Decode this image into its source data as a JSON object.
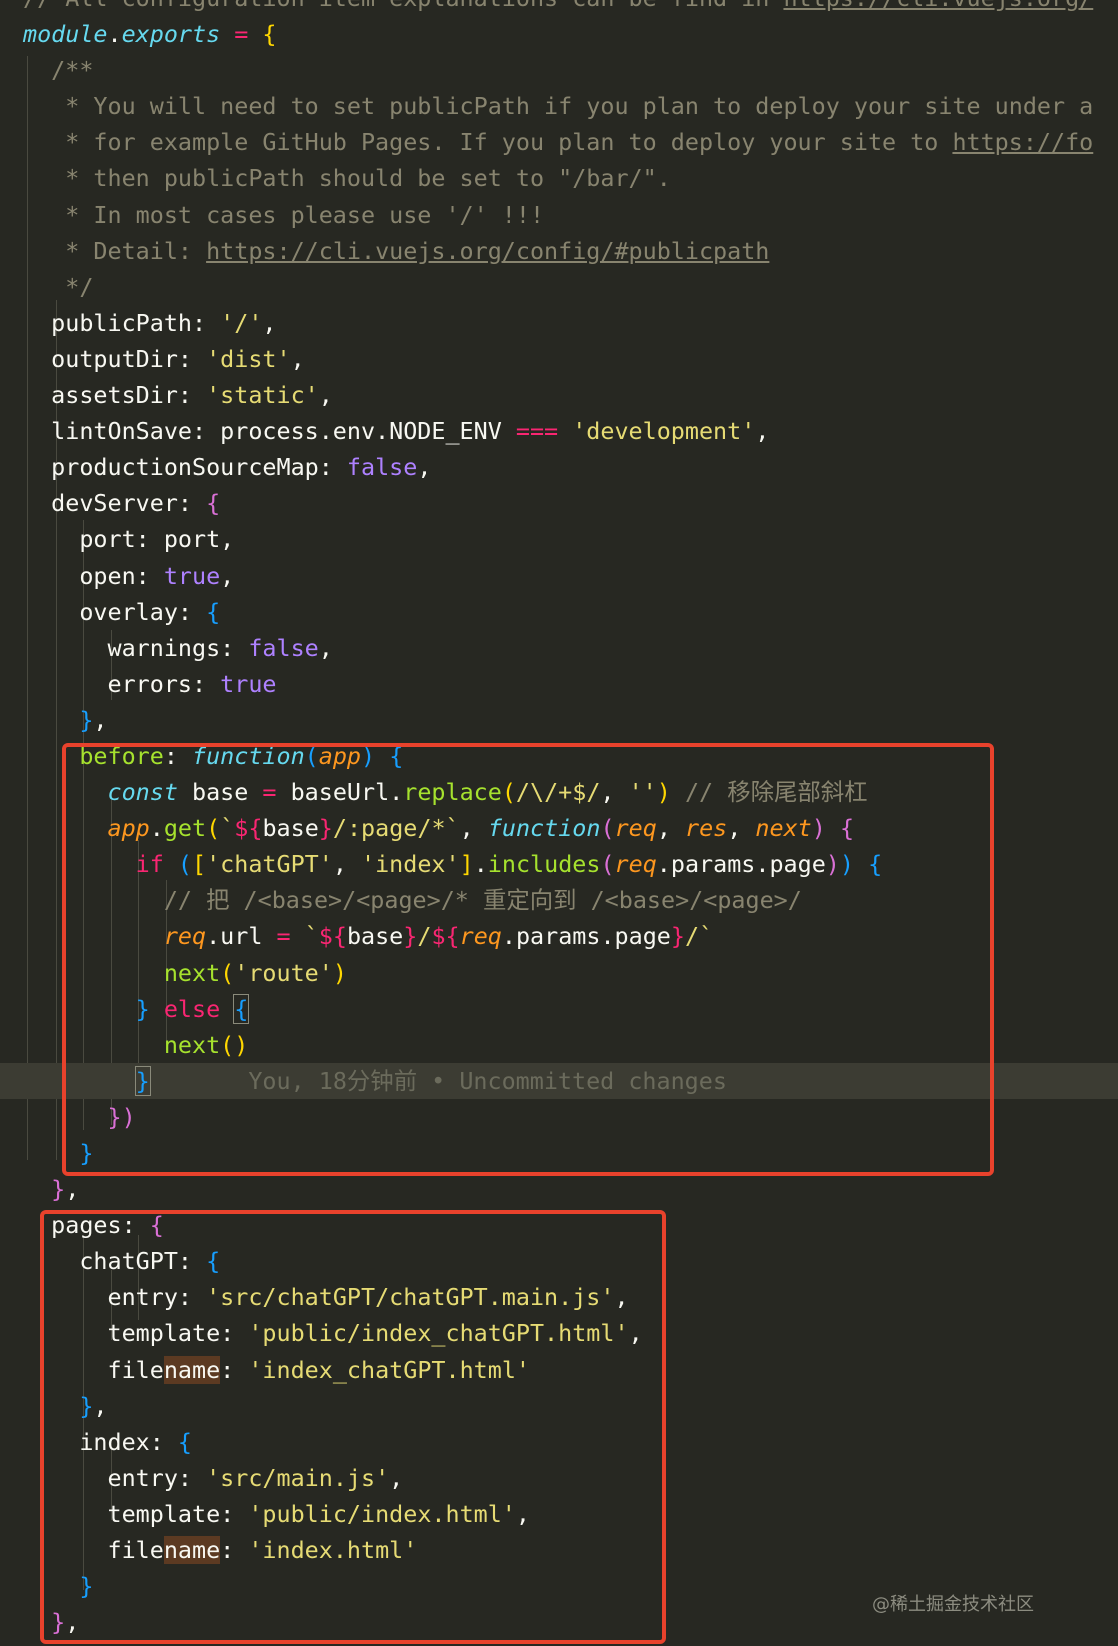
{
  "editor": {
    "lines": [
      {
        "segs": [
          [
            "t-com",
            "// All configuration item explanations can be find in "
          ],
          [
            "t-url",
            "https://cli.vuejs.org/"
          ]
        ]
      },
      {
        "segs": [
          [
            "t-store",
            "module"
          ],
          [
            "",
            "."
          ],
          [
            "t-store",
            "exports"
          ],
          [
            "t-kw",
            " = "
          ],
          [
            "t-b1",
            "{"
          ]
        ]
      },
      {
        "segs": [
          [
            "t-com",
            "  /**"
          ]
        ]
      },
      {
        "segs": [
          [
            "t-com",
            "   * You will need to set publicPath if you plan to deploy your site under a"
          ]
        ]
      },
      {
        "segs": [
          [
            "t-com",
            "   * for example GitHub Pages. If you plan to deploy your site to "
          ],
          [
            "t-url",
            "https://fo"
          ]
        ]
      },
      {
        "segs": [
          [
            "t-com",
            "   * then publicPath should be set to \"/bar/\"."
          ]
        ]
      },
      {
        "segs": [
          [
            "t-com",
            "   * In most cases please use '/' !!!"
          ]
        ]
      },
      {
        "segs": [
          [
            "t-com",
            "   * Detail: "
          ],
          [
            "t-url",
            "https://cli.vuejs.org/config/#publicpath"
          ]
        ]
      },
      {
        "segs": [
          [
            "t-com",
            "   */"
          ]
        ]
      },
      {
        "segs": [
          [
            "",
            "  publicPath: "
          ],
          [
            "t-str",
            "'/'"
          ],
          [
            "",
            ","
          ]
        ]
      },
      {
        "segs": [
          [
            "",
            "  outputDir: "
          ],
          [
            "t-str",
            "'dist'"
          ],
          [
            "",
            ","
          ]
        ]
      },
      {
        "segs": [
          [
            "",
            "  assetsDir: "
          ],
          [
            "t-str",
            "'static'"
          ],
          [
            "",
            ","
          ]
        ]
      },
      {
        "segs": [
          [
            "",
            "  lintOnSave: process.env.NODE_ENV "
          ],
          [
            "t-kw",
            "==="
          ],
          [
            "",
            ""
          ],
          [
            "t-str",
            " 'development'"
          ],
          [
            "",
            ","
          ]
        ]
      },
      {
        "segs": [
          [
            "",
            "  productionSourceMap: "
          ],
          [
            "t-bool",
            "false"
          ],
          [
            "",
            ","
          ]
        ]
      },
      {
        "segs": [
          [
            "",
            "  devServer: "
          ],
          [
            "t-b2",
            "{"
          ]
        ]
      },
      {
        "segs": [
          [
            "",
            "    port: port,"
          ]
        ]
      },
      {
        "segs": [
          [
            "",
            "    open: "
          ],
          [
            "t-bool",
            "true"
          ],
          [
            "",
            ","
          ]
        ]
      },
      {
        "segs": [
          [
            "",
            "    overlay: "
          ],
          [
            "t-b3",
            "{"
          ]
        ]
      },
      {
        "segs": [
          [
            "",
            "      warnings: "
          ],
          [
            "t-bool",
            "false"
          ],
          [
            "",
            ","
          ]
        ]
      },
      {
        "segs": [
          [
            "",
            "      errors: "
          ],
          [
            "t-bool",
            "true"
          ]
        ]
      },
      {
        "segs": [
          [
            "t-b3",
            "    }"
          ],
          [
            "",
            ","
          ]
        ]
      },
      {
        "segs": [
          [
            "t-fn",
            "    before"
          ],
          [
            "",
            ": "
          ],
          [
            "t-store",
            "function"
          ],
          [
            "t-b3",
            "("
          ],
          [
            "t-param",
            "app"
          ],
          [
            "t-b3",
            ")"
          ],
          [
            "",
            ""
          ],
          [
            "t-b3",
            " {"
          ]
        ]
      },
      {
        "segs": [
          [
            "t-store",
            "      const"
          ],
          [
            "",
            " base "
          ],
          [
            "t-kw",
            "="
          ],
          [
            "",
            " baseUrl."
          ],
          [
            "t-fn",
            "replace"
          ],
          [
            "t-b1",
            "("
          ],
          [
            "t-regex",
            "/\\/+$/"
          ],
          [
            "",
            ", "
          ],
          [
            "t-str",
            "''"
          ],
          [
            "t-b1",
            ")"
          ],
          [
            "t-com",
            " // 移除尾部斜杠"
          ]
        ]
      },
      {
        "segs": [
          [
            "t-param",
            "      app"
          ],
          [
            "",
            "."
          ],
          [
            "t-fn",
            "get"
          ],
          [
            "t-b1",
            "("
          ],
          [
            "t-str",
            "`"
          ],
          [
            "t-kw",
            "${"
          ],
          [
            "",
            "base"
          ],
          [
            "t-kw",
            "}"
          ],
          [
            "t-str",
            "/:page/*`"
          ],
          [
            "",
            ", "
          ],
          [
            "t-store",
            "function"
          ],
          [
            "t-b2",
            "("
          ],
          [
            "t-param",
            "req"
          ],
          [
            "",
            ", "
          ],
          [
            "t-param",
            "res"
          ],
          [
            "",
            ", "
          ],
          [
            "t-param",
            "next"
          ],
          [
            "t-b2",
            ")"
          ],
          [
            "t-b2",
            " {"
          ]
        ]
      },
      {
        "segs": [
          [
            "t-kw",
            "        if"
          ],
          [
            "t-b3",
            " ("
          ],
          [
            "t-b1",
            "["
          ],
          [
            "t-str",
            "'chatGPT'"
          ],
          [
            "",
            ", "
          ],
          [
            "t-str",
            "'index'"
          ],
          [
            "t-b1",
            "]"
          ],
          [
            "",
            "."
          ],
          [
            "t-fn",
            "includes"
          ],
          [
            "t-b2",
            "("
          ],
          [
            "t-param",
            "req"
          ],
          [
            "",
            ".params.page"
          ],
          [
            "t-b2",
            ")"
          ],
          [
            "t-b3",
            ")"
          ],
          [
            "t-b3",
            " {"
          ]
        ]
      },
      {
        "segs": [
          [
            "t-com",
            "          // 把 /<base>/<page>/* 重定向到 /<base>/<page>/"
          ]
        ]
      },
      {
        "segs": [
          [
            "t-param",
            "          req"
          ],
          [
            "",
            ".url "
          ],
          [
            "t-kw",
            "="
          ],
          [
            "t-str",
            " `"
          ],
          [
            "t-kw",
            "${"
          ],
          [
            "",
            "base"
          ],
          [
            "t-kw",
            "}"
          ],
          [
            "t-str",
            "/"
          ],
          [
            "t-kw",
            "${"
          ],
          [
            "t-param",
            "req"
          ],
          [
            "",
            ".params.page"
          ],
          [
            "t-kw",
            "}"
          ],
          [
            "t-str",
            "/`"
          ]
        ]
      },
      {
        "segs": [
          [
            "t-fn",
            "          next"
          ],
          [
            "t-b1",
            "("
          ],
          [
            "t-str",
            "'route'"
          ],
          [
            "t-b1",
            ")"
          ]
        ]
      },
      {
        "segs": [
          [
            "t-b3",
            "        }"
          ],
          [
            "t-kw",
            " else "
          ],
          [
            "t-b3 t-bracketbox",
            "{"
          ]
        ]
      },
      {
        "segs": [
          [
            "t-fn",
            "          next"
          ],
          [
            "t-b1",
            "()"
          ]
        ]
      },
      {
        "segs": [
          [
            "",
            "        "
          ],
          [
            "t-b3 t-bracketbox",
            "}"
          ],
          [
            "t-ghost",
            "       You, 18分钟前 • Uncommitted changes"
          ]
        ],
        "current": true
      },
      {
        "segs": [
          [
            "t-b2",
            "      })"
          ]
        ]
      },
      {
        "segs": [
          [
            "t-b3",
            "    }"
          ]
        ]
      },
      {
        "segs": [
          [
            "t-b2",
            "  }"
          ],
          [
            "",
            ","
          ]
        ]
      },
      {
        "segs": [
          [
            "",
            "  pages: "
          ],
          [
            "t-b2",
            "{"
          ]
        ]
      },
      {
        "segs": [
          [
            "",
            "    chatGPT: "
          ],
          [
            "t-b3",
            "{"
          ]
        ]
      },
      {
        "segs": [
          [
            "",
            "      entry: "
          ],
          [
            "t-str",
            "'src/chatGPT/chatGPT.main.js'"
          ],
          [
            "",
            ","
          ]
        ]
      },
      {
        "segs": [
          [
            "",
            "      template: "
          ],
          [
            "t-str",
            "'public/index_chatGPT.html'"
          ],
          [
            "",
            ","
          ]
        ]
      },
      {
        "segs": [
          [
            "",
            "      file"
          ],
          [
            "t-hl",
            "name"
          ],
          [
            "",
            ": "
          ],
          [
            "t-str",
            "'index_chatGPT.html'"
          ]
        ]
      },
      {
        "segs": [
          [
            "t-b3",
            "    }"
          ],
          [
            "",
            ","
          ]
        ]
      },
      {
        "segs": [
          [
            "",
            "    index: "
          ],
          [
            "t-b3",
            "{"
          ]
        ]
      },
      {
        "segs": [
          [
            "",
            "      entry: "
          ],
          [
            "t-str",
            "'src/main.js'"
          ],
          [
            "",
            ","
          ]
        ]
      },
      {
        "segs": [
          [
            "",
            "      template: "
          ],
          [
            "t-str",
            "'public/index.html'"
          ],
          [
            "",
            ","
          ]
        ]
      },
      {
        "segs": [
          [
            "",
            "      file"
          ],
          [
            "t-hl",
            "name"
          ],
          [
            "",
            ": "
          ],
          [
            "t-str",
            "'index.html'"
          ]
        ]
      },
      {
        "segs": [
          [
            "t-b3",
            "    }"
          ]
        ]
      },
      {
        "segs": [
          [
            "t-b2",
            "  }"
          ],
          [
            "",
            ","
          ]
        ]
      }
    ]
  },
  "watermark": "@稀土掘金技术社区"
}
